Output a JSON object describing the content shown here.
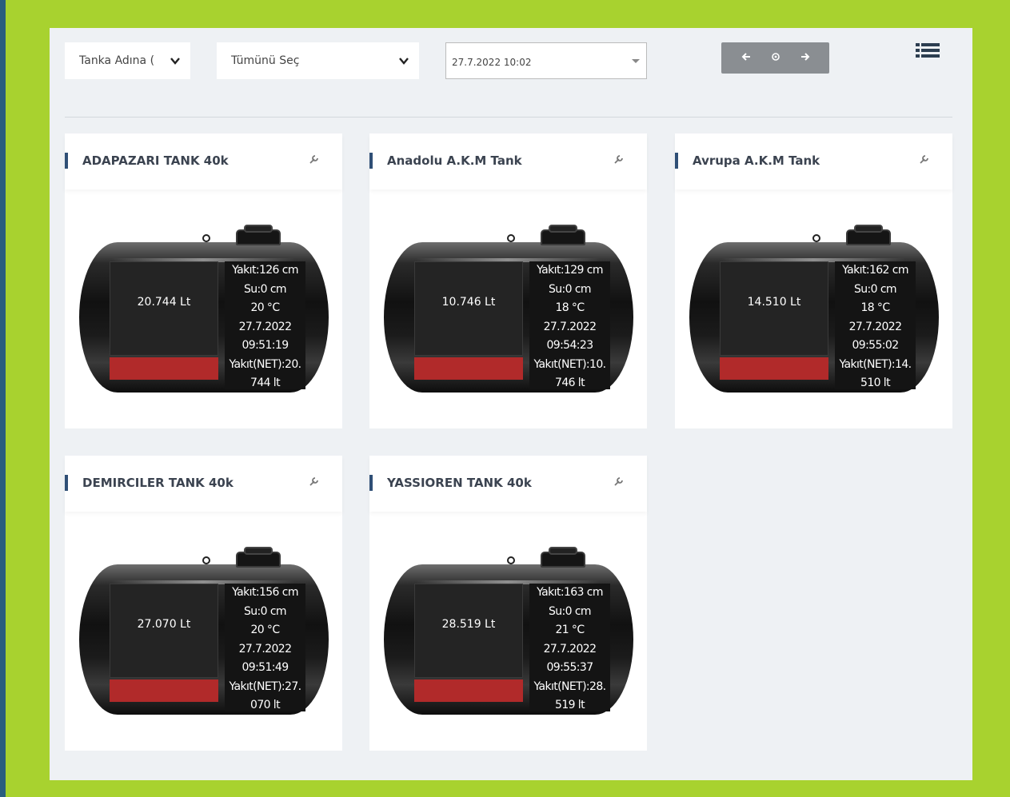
{
  "toolbar": {
    "sort_select": "Tanka Adına (",
    "group_select": "Tümünü Seç",
    "date_select": "27.7.2022 10:02",
    "prev_label": "🡐",
    "reset_label": "⊙",
    "next_label": "🡒"
  },
  "colors": {
    "background": "#a8d22f",
    "panel": "#eef1f4",
    "accent": "#2f4f76",
    "fill_red": "#b12a2a"
  },
  "tanks": [
    {
      "name": "ADAPAZARI TANK 40k",
      "liters": "20.744 Lt",
      "fuel": "Yakıt:126 cm",
      "water": "Su:0 cm",
      "temp": "20 °C",
      "date": "27.7.2022",
      "time": "09:51:19",
      "net1": "Yakıt(NET):20.",
      "net2": "744 lt"
    },
    {
      "name": "Anadolu A.K.M Tank",
      "liters": "10.746 Lt",
      "fuel": "Yakıt:129 cm",
      "water": "Su:0 cm",
      "temp": "18 °C",
      "date": "27.7.2022",
      "time": "09:54:23",
      "net1": "Yakıt(NET):10.",
      "net2": "746 lt"
    },
    {
      "name": "Avrupa A.K.M Tank",
      "liters": "14.510 Lt",
      "fuel": "Yakıt:162 cm",
      "water": "Su:0 cm",
      "temp": "18 °C",
      "date": "27.7.2022",
      "time": "09:55:02",
      "net1": "Yakıt(NET):14.",
      "net2": "510 lt"
    },
    {
      "name": "DEMIRCILER TANK 40k",
      "liters": "27.070 Lt",
      "fuel": "Yakıt:156 cm",
      "water": "Su:0 cm",
      "temp": "20 °C",
      "date": "27.7.2022",
      "time": "09:51:49",
      "net1": "Yakıt(NET):27.",
      "net2": "070 lt"
    },
    {
      "name": "YASSIOREN TANK 40k",
      "liters": "28.519 Lt",
      "fuel": "Yakıt:163 cm",
      "water": "Su:0 cm",
      "temp": "21 °C",
      "date": "27.7.2022",
      "time": "09:55:37",
      "net1": "Yakıt(NET):28.",
      "net2": "519 lt"
    }
  ]
}
